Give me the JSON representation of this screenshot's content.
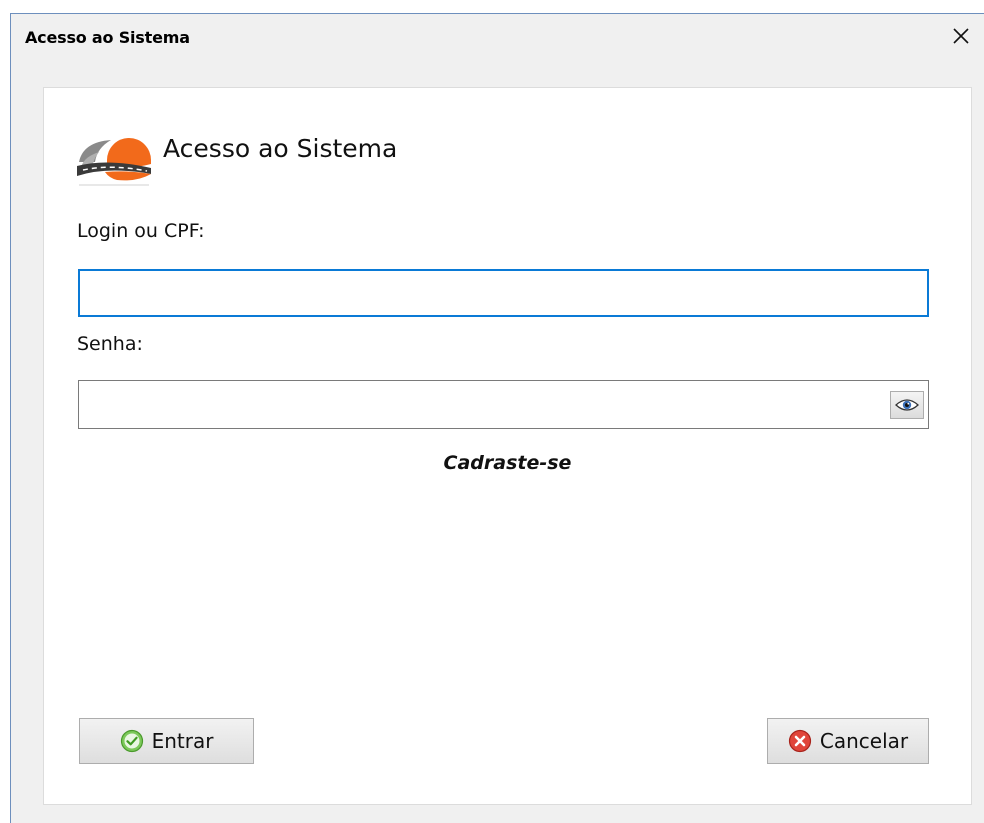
{
  "window": {
    "title": "Acesso ao Sistema",
    "close_icon": "close-icon"
  },
  "header": {
    "title": "Acesso ao Sistema",
    "logo_icon": "road-logo-icon"
  },
  "form": {
    "login_label": "Login ou CPF:",
    "login_value": "",
    "login_placeholder": "",
    "password_label": "Senha:",
    "password_value": "",
    "password_placeholder": "",
    "show_password_icon": "eye-icon",
    "register_link": "Cadraste-se"
  },
  "buttons": {
    "enter_label": "Entrar",
    "enter_icon": "check-circle-icon",
    "cancel_label": "Cancelar",
    "cancel_icon": "cancel-circle-icon"
  },
  "colors": {
    "focus_border": "#0a7ad6",
    "logo_orange": "#f26a1b",
    "logo_gray": "#8a8a8a",
    "enter_icon_green": "#5cb83a",
    "cancel_icon_red": "#d9342b"
  }
}
